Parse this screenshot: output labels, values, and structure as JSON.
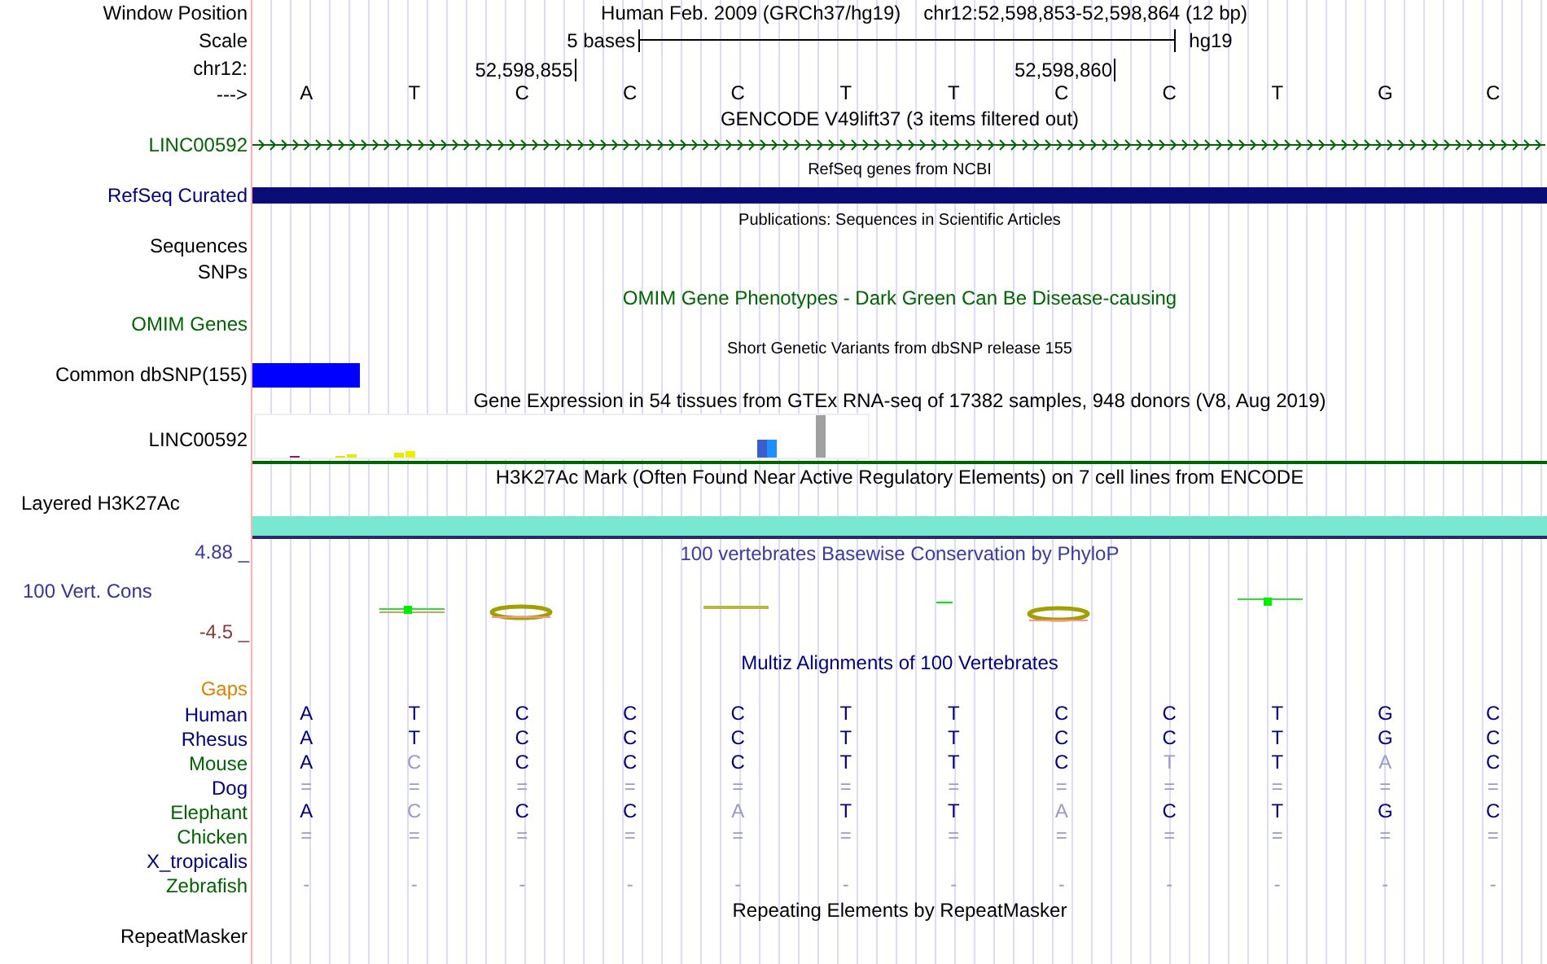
{
  "rows": [
    {
      "kind": "position",
      "label": "Window Position",
      "color": "#000000",
      "title": "Human Feb. 2009 (GRCh37/hg19)",
      "position": "chr12:52,598,853-52,598,864 (12 bp)"
    },
    {
      "kind": "scale",
      "label": "Scale",
      "color": "#000000",
      "scale_text": "5 bases",
      "assembly": "hg19"
    },
    {
      "kind": "ticks",
      "label": "chr12:",
      "color": "#000000",
      "ticks": [
        {
          "text": "52,598,855"
        },
        {
          "text": "52,598,860"
        }
      ]
    },
    {
      "kind": "bases",
      "label": "--->",
      "color": "#000000",
      "bases": [
        "A",
        "T",
        "C",
        "C",
        "C",
        "T",
        "T",
        "C",
        "C",
        "T",
        "G",
        "C"
      ]
    },
    {
      "kind": "title",
      "text": "GENCODE V49lift37 (3 items filtered out)",
      "color": "#000000"
    },
    {
      "kind": "gene",
      "label": "LINC00592",
      "color": "#006400"
    },
    {
      "kind": "note",
      "text": "RefSeq genes from NCBI",
      "color": "#000000"
    },
    {
      "kind": "gene_bar",
      "label": "RefSeq Curated",
      "color": "#000080",
      "bar": {
        "color": "#0c0c78"
      }
    },
    {
      "kind": "note",
      "text": "Publications: Sequences in Scientific Articles",
      "color": "#000000"
    },
    {
      "kind": "label",
      "label": "Sequences",
      "color": "#000000"
    },
    {
      "kind": "label",
      "label": "SNPs",
      "color": "#000000"
    },
    {
      "kind": "title",
      "text": "OMIM Gene Phenotypes - Dark Green Can Be Disease-causing",
      "color": "#006400"
    },
    {
      "kind": "label",
      "label": "OMIM Genes",
      "color": "#006400"
    },
    {
      "kind": "note",
      "text": "Short Genetic Variants from dbSNP release 155",
      "color": "#000000"
    },
    {
      "kind": "variant_bar",
      "label": "Common dbSNP(155)",
      "color": "#000000",
      "bar": {
        "color": "#0000ff"
      }
    },
    {
      "kind": "title",
      "text": "Gene Expression in 54 tissues from GTEx RNA-seq of 17382 samples, 948 donors (V8, Aug 2019)",
      "color": "#000000"
    },
    {
      "kind": "expression",
      "label": "LINC00592",
      "color": "#000000"
    },
    {
      "kind": "title",
      "text": "H3K27Ac Mark (Often Found Near Active Regulatory Elements) on 7 cell lines from ENCODE",
      "color": "#000000"
    },
    {
      "kind": "layered",
      "label": "Layered H3K27Ac",
      "color": "#000000"
    },
    {
      "kind": "conservation",
      "label": "100 Vert. Cons",
      "color": "#333399",
      "max": "4.88 _",
      "min": "-4.5 _",
      "title": "100 vertebrates Basewise Conservation by PhyloP"
    },
    {
      "kind": "title",
      "text": "Multiz Alignments of 100 Vertebrates",
      "color": "#000080"
    },
    {
      "kind": "label",
      "label": "Gaps",
      "color": "#e08000"
    },
    {
      "kind": "species",
      "label": "Human",
      "color": "#000080",
      "bases": [
        {
          "text": "A",
          "faded": false
        },
        {
          "text": "T",
          "faded": false
        },
        {
          "text": "C",
          "faded": false
        },
        {
          "text": "C",
          "faded": false
        },
        {
          "text": "C",
          "faded": false
        },
        {
          "text": "T",
          "faded": false
        },
        {
          "text": "T",
          "faded": false
        },
        {
          "text": "C",
          "faded": false
        },
        {
          "text": "C",
          "faded": false
        },
        {
          "text": "T",
          "faded": false
        },
        {
          "text": "G",
          "faded": false
        },
        {
          "text": "C",
          "faded": false
        }
      ]
    },
    {
      "kind": "species",
      "label": "Rhesus",
      "color": "#000080",
      "bases": [
        {
          "text": "A",
          "faded": false
        },
        {
          "text": "T",
          "faded": false
        },
        {
          "text": "C",
          "faded": false
        },
        {
          "text": "C",
          "faded": false
        },
        {
          "text": "C",
          "faded": false
        },
        {
          "text": "T",
          "faded": false
        },
        {
          "text": "T",
          "faded": false
        },
        {
          "text": "C",
          "faded": false
        },
        {
          "text": "C",
          "faded": false
        },
        {
          "text": "T",
          "faded": false
        },
        {
          "text": "G",
          "faded": false
        },
        {
          "text": "C",
          "faded": false
        }
      ]
    },
    {
      "kind": "species",
      "label": "Mouse",
      "color": "#006400",
      "bases": [
        {
          "text": "A",
          "faded": false
        },
        {
          "text": "C",
          "faded": true
        },
        {
          "text": "C",
          "faded": false
        },
        {
          "text": "C",
          "faded": false
        },
        {
          "text": "C",
          "faded": false
        },
        {
          "text": "T",
          "faded": false
        },
        {
          "text": "T",
          "faded": false
        },
        {
          "text": "C",
          "faded": false
        },
        {
          "text": "T",
          "faded": true
        },
        {
          "text": "T",
          "faded": false
        },
        {
          "text": "A",
          "faded": true
        },
        {
          "text": "C",
          "faded": false
        }
      ]
    },
    {
      "kind": "species",
      "label": "Dog",
      "color": "#000080",
      "bases": [
        {
          "text": "=",
          "faded": true
        },
        {
          "text": "=",
          "faded": true
        },
        {
          "text": "=",
          "faded": true
        },
        {
          "text": "=",
          "faded": true
        },
        {
          "text": "=",
          "faded": true
        },
        {
          "text": "=",
          "faded": true
        },
        {
          "text": "=",
          "faded": true
        },
        {
          "text": "=",
          "faded": true
        },
        {
          "text": "=",
          "faded": true
        },
        {
          "text": "=",
          "faded": true
        },
        {
          "text": "=",
          "faded": true
        },
        {
          "text": "=",
          "faded": true
        }
      ]
    },
    {
      "kind": "species",
      "label": "Elephant",
      "color": "#006400",
      "bases": [
        {
          "text": "A",
          "faded": false
        },
        {
          "text": "C",
          "faded": true
        },
        {
          "text": "C",
          "faded": false
        },
        {
          "text": "C",
          "faded": false
        },
        {
          "text": "A",
          "faded": true
        },
        {
          "text": "T",
          "faded": false
        },
        {
          "text": "T",
          "faded": false
        },
        {
          "text": "A",
          "faded": true
        },
        {
          "text": "C",
          "faded": false
        },
        {
          "text": "T",
          "faded": false
        },
        {
          "text": "G",
          "faded": false
        },
        {
          "text": "C",
          "faded": false
        }
      ]
    },
    {
      "kind": "species",
      "label": "Chicken",
      "color": "#006400",
      "bases": [
        {
          "text": "=",
          "faded": true
        },
        {
          "text": "=",
          "faded": true
        },
        {
          "text": "=",
          "faded": true
        },
        {
          "text": "=",
          "faded": true
        },
        {
          "text": "=",
          "faded": true
        },
        {
          "text": "=",
          "faded": true
        },
        {
          "text": "=",
          "faded": true
        },
        {
          "text": "=",
          "faded": true
        },
        {
          "text": "=",
          "faded": true
        },
        {
          "text": "=",
          "faded": true
        },
        {
          "text": "=",
          "faded": true
        },
        {
          "text": "=",
          "faded": true
        }
      ]
    },
    {
      "kind": "species",
      "label": "X_tropicalis",
      "color": "#000080"
    },
    {
      "kind": "species",
      "label": "Zebrafish",
      "color": "#006400",
      "bases": [
        {
          "text": "-",
          "faded": true
        },
        {
          "text": "-",
          "faded": true
        },
        {
          "text": "-",
          "faded": true
        },
        {
          "text": "-",
          "faded": true
        },
        {
          "text": "-",
          "faded": true
        },
        {
          "text": "-",
          "faded": true
        },
        {
          "text": "-",
          "faded": true
        },
        {
          "text": "-",
          "faded": true
        },
        {
          "text": "-",
          "faded": true
        },
        {
          "text": "-",
          "faded": true
        },
        {
          "text": "-",
          "faded": true
        },
        {
          "text": "-",
          "faded": true
        }
      ]
    },
    {
      "kind": "title",
      "text": "Repeating Elements by RepeatMasker",
      "color": "#000000"
    },
    {
      "kind": "label",
      "label": "RepeatMasker",
      "color": "#000000"
    }
  ]
}
